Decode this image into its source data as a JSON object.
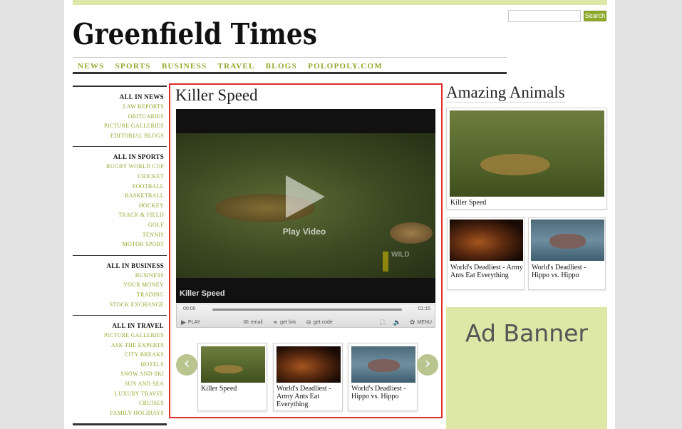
{
  "brand": {
    "masthead": "Greenfield Times"
  },
  "search": {
    "placeholder": "",
    "button_label": "Search"
  },
  "nav": [
    "NEWS",
    "SPORTS",
    "BUSINESS",
    "TRAVEL",
    "BLOGS",
    "POLOPOLY.COM"
  ],
  "sidebar": [
    {
      "title": "ALL IN NEWS",
      "links": [
        "LAW REPORTS",
        "OBITUARIES",
        "PICTURE GALLERIES",
        "EDITORIAL BLOGS"
      ]
    },
    {
      "title": "ALL IN SPORTS",
      "links": [
        "RUGBY WORLD CUP",
        "CRICKET",
        "FOOTBALL",
        "BASKETBALL",
        "HOCKEY",
        "TRACK & FIELD",
        "GOLF",
        "TENNIS",
        "MOTOR SPORT"
      ]
    },
    {
      "title": "ALL IN BUSINESS",
      "links": [
        "BUSINESS",
        "YOUR MONEY",
        "TRADING",
        "STOCK EXCHANGE"
      ]
    },
    {
      "title": "ALL IN TRAVEL",
      "links": [
        "PICTURE GALLERIES",
        "ASK THE EXPERTS",
        "CITY BREAKS",
        "HOTELS",
        "SNOW AND SKI",
        "SUN AND SEA",
        "LUXURY TRAVEL",
        "CRUISES",
        "FAMILY HOLIDAYS"
      ]
    }
  ],
  "player": {
    "title": "Killer Speed",
    "play_label": "Play Video",
    "caption": "Killer Speed",
    "watermark": "WILD",
    "time_start": "00:00",
    "time_end": "01:15",
    "controls": {
      "play": "PLAY",
      "email": "email",
      "get_link": "get link",
      "get_code": "get code",
      "menu": "MENU"
    },
    "carousel": [
      {
        "caption": "Killer Speed",
        "image": "cheetah"
      },
      {
        "caption": "World's Deadliest - Army Ants Eat Everything",
        "image": "ants"
      },
      {
        "caption": "World's Deadliest - Hippo vs. Hippo",
        "image": "hippo"
      }
    ]
  },
  "right": {
    "title": "Amazing Animals",
    "feature": {
      "caption": "Killer Speed"
    },
    "small": [
      {
        "caption": "World's Deadliest - Army Ants Eat Everything"
      },
      {
        "caption": "World's Deadliest - Hippo vs. Hippo"
      }
    ],
    "ad_text": "Ad Banner"
  },
  "colors": {
    "accent": "#8eaa2c",
    "ad_background": "#dde8a6",
    "highlight_border": "#e02b2b"
  },
  "icons": {
    "prev": "chevron-left-icon",
    "next": "chevron-right-icon",
    "play": "play-icon"
  }
}
